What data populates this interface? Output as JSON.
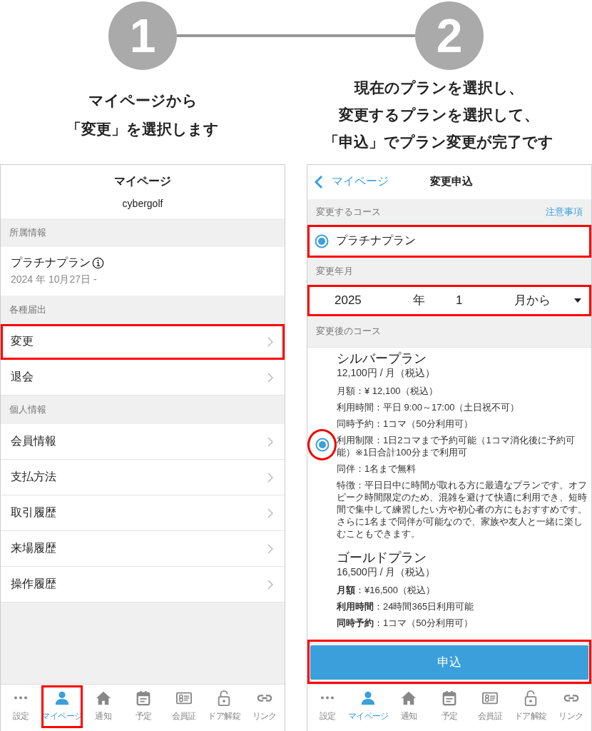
{
  "steps": [
    {
      "number": "1",
      "caption_lines": [
        "マイページから",
        "「変更」を選択します"
      ]
    },
    {
      "number": "2",
      "caption_lines": [
        "現在のプランを選択し、",
        "変更するプランを選択して、",
        "「申込」でプラン変更が完了です"
      ]
    }
  ],
  "mypage_screen": {
    "title": "マイページ",
    "username": "cybergolf",
    "sections": [
      {
        "header": "所属情報",
        "plan": {
          "name": "プラチナプラン",
          "since": "2024 年 10月27日 -"
        }
      },
      {
        "header": "各種届出",
        "rows": [
          {
            "label": "変更",
            "highlighted": true
          },
          {
            "label": "退会",
            "highlighted": false
          }
        ]
      },
      {
        "header": "個人情報",
        "rows": [
          {
            "label": "会員情報",
            "highlighted": false
          },
          {
            "label": "支払方法",
            "highlighted": false
          },
          {
            "label": "取引履歴",
            "highlighted": false
          },
          {
            "label": "来場履歴",
            "highlighted": false
          },
          {
            "label": "操作履歴",
            "highlighted": false
          }
        ]
      }
    ],
    "tab_bar": [
      {
        "label": "設定",
        "selected": false,
        "highlighted": false
      },
      {
        "label": "マイページ",
        "selected": true,
        "highlighted": true
      },
      {
        "label": "通知",
        "selected": false,
        "highlighted": false
      },
      {
        "label": "予定",
        "selected": false,
        "highlighted": false
      },
      {
        "label": "会員証",
        "selected": false,
        "highlighted": false
      },
      {
        "label": "ドア解錠",
        "selected": false,
        "highlighted": false
      },
      {
        "label": "リンク",
        "selected": false,
        "highlighted": false
      }
    ]
  },
  "change_screen": {
    "back_label": "マイページ",
    "title": "変更申込",
    "current_course": {
      "header": "変更するコース",
      "notes_link": "注意事項",
      "plan": "プラチナプラン",
      "selected": true,
      "highlighted": true
    },
    "change_date": {
      "header": "変更年月",
      "year": "2025",
      "year_unit": "年",
      "month": "1",
      "month_unit": "月から",
      "highlighted": true
    },
    "new_course": {
      "header": "変更後のコース",
      "options": [
        {
          "name": "シルバープラン",
          "price": "12,100円 / 月（税込）",
          "selected": true,
          "highlighted": true,
          "details": [
            "月額：¥ 12,100（税込）",
            "利用時間：平日 9:00～17:00（土日祝不可）",
            "同時予約：1コマ（50分利用可）",
            "利用制限：1日2コマまで予約可能（1コマ消化後に予約可能）※1日合計100分まで利用可",
            "同伴：1名まで無料",
            "特徴：平日日中に時間が取れる方に最適なプランです。オフピーク時間限定のため、混雑を避けて快適に利用でき、短時間で集中して練習したい方や初心者の方にもおすすめです。さらに1名まで同伴が可能なので、家族や友人と一緒に楽しむこともできます。"
          ]
        },
        {
          "name": "ゴールドプラン",
          "price": "16,500円 / 月（税込）",
          "selected": false,
          "highlighted": false,
          "details": [
            "**月額**：¥16,500（税込）",
            "**利用時間**：24時間365日利用可能",
            "**同時予約**：1コマ（50分利用可）"
          ]
        }
      ]
    },
    "apply_button": {
      "label": "申込",
      "highlighted": true
    },
    "tab_bar": [
      {
        "label": "設定",
        "selected": false,
        "highlighted": false
      },
      {
        "label": "マイページ",
        "selected": true,
        "highlighted": false
      },
      {
        "label": "通知",
        "selected": false,
        "highlighted": false
      },
      {
        "label": "予定",
        "selected": false,
        "highlighted": false
      },
      {
        "label": "会員証",
        "selected": false,
        "highlighted": false
      },
      {
        "label": "ドア解錠",
        "selected": false,
        "highlighted": false
      },
      {
        "label": "リンク",
        "selected": false,
        "highlighted": false
      }
    ]
  }
}
